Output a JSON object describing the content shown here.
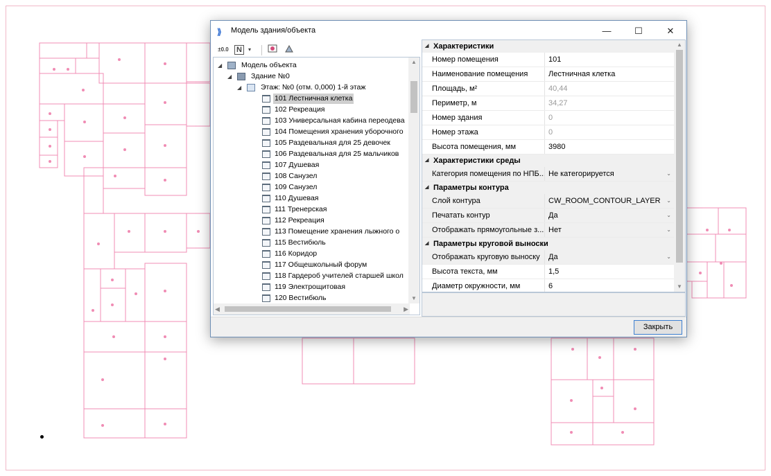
{
  "window": {
    "title": "Модель здания/объекта",
    "minimize": "—",
    "maximize": "☐",
    "close": "✕"
  },
  "toolbar": {
    "buttons": [
      "elevation-marker-tool",
      "level-n-dropdown",
      "room-tool",
      "settings-tool"
    ],
    "level_label": "N",
    "elev_label": "±0.0"
  },
  "tree": {
    "root": "Модель объекта",
    "building": "Здание №0",
    "floor": "Этаж: №0 (отм. 0,000) 1-й этаж",
    "rooms": [
      "101 Лестничная клетка",
      "102 Рекреация",
      "103 Универсальная кабина переодева",
      "104 Помещения хранения уборочного",
      "105 Раздевальная для 25 девочек",
      "106 Раздевальная для 25 мальчиков",
      "107 Душевая",
      "108 Санузел",
      "109 Санузел",
      "110 Душевая",
      "111 Тренерская",
      "112 Рекреация",
      "113 Помещение хранения лыжного о",
      "115 Вестибюль",
      "116 Коридор",
      "117 Общешкольный форум",
      "118 Гардероб учителей старшей школ",
      "119 Электрощитовая",
      "120 Вестибюль"
    ],
    "selected_index": 0
  },
  "properties": {
    "categories": [
      {
        "name": "Характеристики",
        "rows": [
          {
            "name": "Номер помещения",
            "value": "101",
            "readonly": false,
            "dropdown": false
          },
          {
            "name": "Наименование помещения",
            "value": "Лестничная клетка",
            "readonly": false,
            "dropdown": false
          },
          {
            "name": "Площадь, м²",
            "value": "40,44",
            "readonly": true,
            "dropdown": false
          },
          {
            "name": "Периметр, м",
            "value": "34,27",
            "readonly": true,
            "dropdown": false
          },
          {
            "name": "Номер здания",
            "value": "0",
            "readonly": true,
            "dropdown": false
          },
          {
            "name": "Номер этажа",
            "value": "0",
            "readonly": true,
            "dropdown": false
          },
          {
            "name": "Высота помещения, мм",
            "value": "3980",
            "readonly": false,
            "dropdown": false
          }
        ]
      },
      {
        "name": "Характеристики среды",
        "rows": [
          {
            "name": "Категория помещения по НПБ...",
            "value": "Не категорируется",
            "readonly": false,
            "dropdown": true
          }
        ]
      },
      {
        "name": "Параметры контура",
        "rows": [
          {
            "name": "Слой контура",
            "value": "CW_ROOM_CONTOUR_LAYER",
            "readonly": false,
            "dropdown": true
          },
          {
            "name": "Печатать контур",
            "value": "Да",
            "readonly": false,
            "dropdown": true
          },
          {
            "name": "Отображать прямоугольные з...",
            "value": "Нет",
            "readonly": false,
            "dropdown": true
          }
        ]
      },
      {
        "name": "Параметры круговой выноски",
        "rows": [
          {
            "name": "Отображать круговую выноску",
            "value": "Да",
            "readonly": false,
            "dropdown": true
          },
          {
            "name": "Высота текста, мм",
            "value": "1,5",
            "readonly": false,
            "dropdown": false
          },
          {
            "name": "Диаметр окружности, мм",
            "value": "6",
            "readonly": false,
            "dropdown": false
          }
        ]
      }
    ]
  },
  "footer": {
    "close_label": "Закрыть"
  },
  "colors": {
    "cad_lines": "#e87aa8",
    "dialog_border": "#6e8fb5",
    "selection": "#cfcfcf",
    "category_bg": "#f0f0f0"
  }
}
